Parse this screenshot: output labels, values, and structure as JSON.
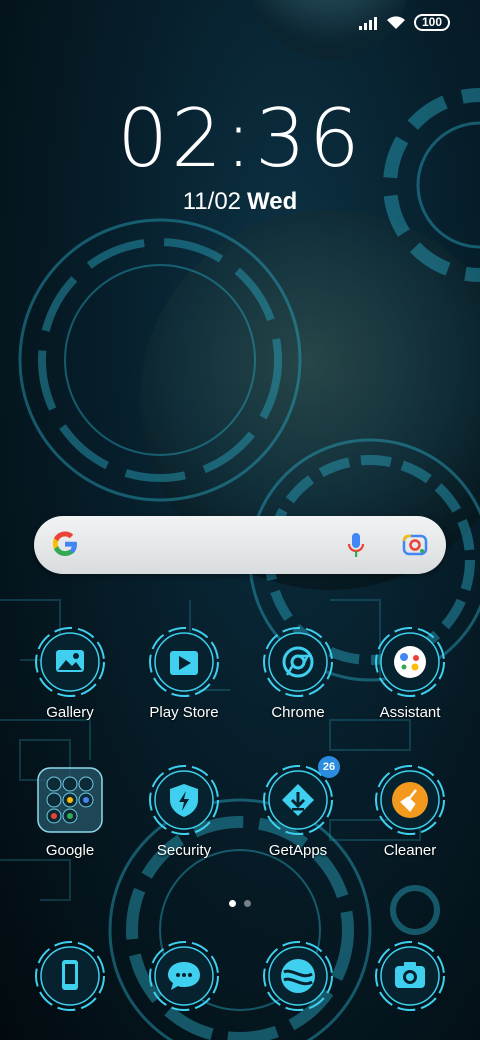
{
  "status_bar": {
    "battery": "100"
  },
  "lock": {
    "time": "02:36",
    "date": "11/02",
    "weekday": "Wed"
  },
  "search": {
    "placeholder": ""
  },
  "apps_row1": [
    {
      "label": "Gallery",
      "icon": "gallery-icon"
    },
    {
      "label": "Play Store",
      "icon": "play-store-icon"
    },
    {
      "label": "Chrome",
      "icon": "chrome-icon"
    },
    {
      "label": "Assistant",
      "icon": "assistant-icon"
    }
  ],
  "apps_row2": [
    {
      "label": "Google",
      "icon": "google-folder-icon"
    },
    {
      "label": "Security",
      "icon": "security-icon"
    },
    {
      "label": "GetApps",
      "icon": "getapps-icon",
      "badge": "26"
    },
    {
      "label": "Cleaner",
      "icon": "cleaner-icon"
    }
  ],
  "dock": [
    {
      "icon": "phone-icon"
    },
    {
      "icon": "messages-icon"
    },
    {
      "icon": "browser-icon"
    },
    {
      "icon": "camera-icon"
    }
  ],
  "page_indicator": {
    "pages": 2,
    "current": 1
  },
  "colors": {
    "accent": "#3fd0f0",
    "badge": "#2b8de0",
    "cleaner": "#f39a1e"
  }
}
